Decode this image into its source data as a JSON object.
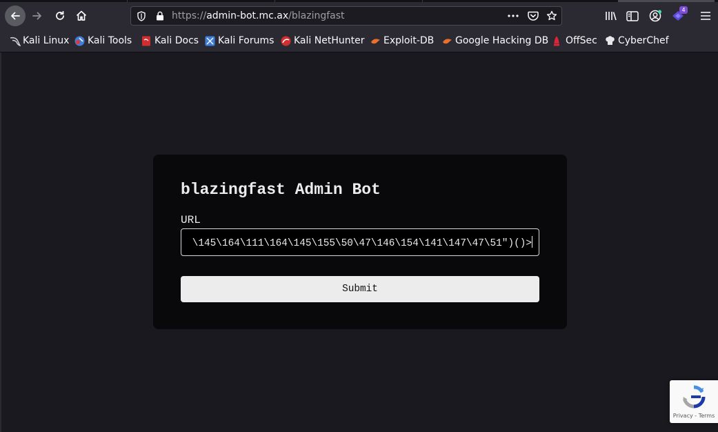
{
  "browser": {
    "url_prefix": "https://",
    "url_host": "admin-bot.mc.ax",
    "url_path": "/blazingfast",
    "extensions_badge": "4"
  },
  "bookmarks": [
    {
      "label": "Kali Linux",
      "icon": "kali-dragon-icon"
    },
    {
      "label": "Kali Tools",
      "icon": "kali-tools-icon"
    },
    {
      "label": "Kali Docs",
      "icon": "kali-docs-icon"
    },
    {
      "label": "Kali Forums",
      "icon": "kali-forums-icon"
    },
    {
      "label": "Kali NetHunter",
      "icon": "kali-nethunter-icon"
    },
    {
      "label": "Exploit-DB",
      "icon": "exploit-db-icon"
    },
    {
      "label": "Google Hacking DB",
      "icon": "google-hacking-db-icon"
    },
    {
      "label": "OffSec",
      "icon": "offsec-icon"
    },
    {
      "label": "CyberChef",
      "icon": "cyberchef-icon"
    }
  ],
  "card": {
    "title": "blazingfast Admin Bot",
    "url_label": "URL",
    "url_value": "\\145\\164\\111\\164\\145\\155\\50\\47\\146\\154\\141\\147\\47\\51\")()>",
    "submit_label": "Submit"
  },
  "recaptcha": {
    "privacy": "Privacy",
    "separator": " - ",
    "terms": "Terms"
  },
  "colors": {
    "page_bg": "#1a191f",
    "card_bg": "#09090b",
    "button_bg": "#ececec",
    "chrome_bg": "#2b2a33"
  }
}
